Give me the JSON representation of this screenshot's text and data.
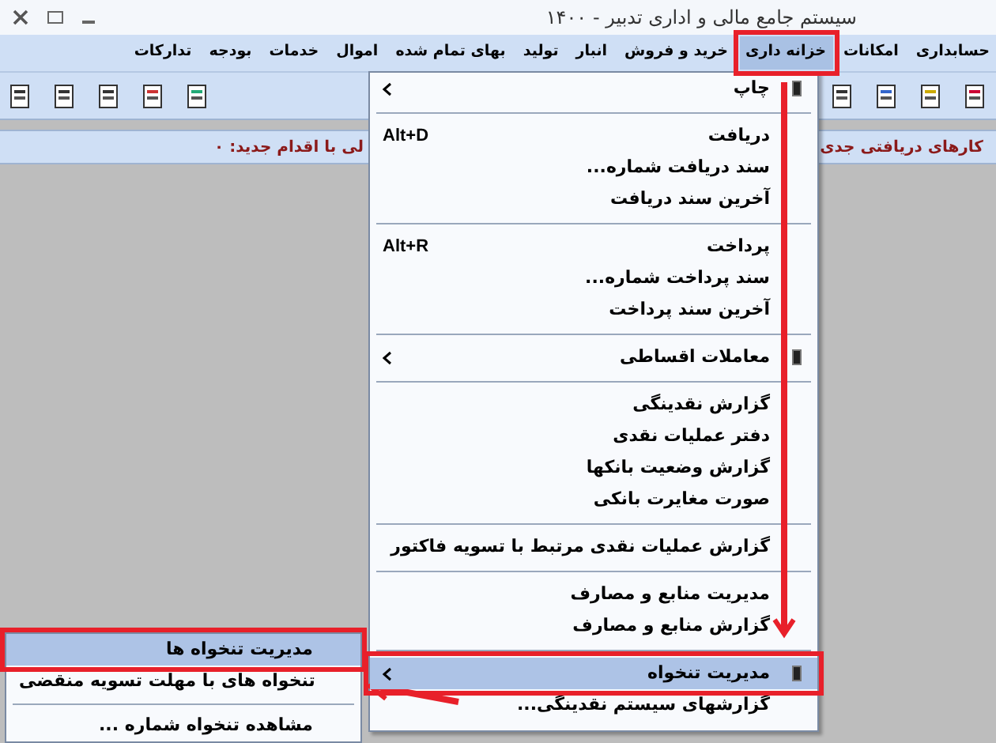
{
  "window": {
    "title": "سیستم جامع مالی و اداری تدبیر - ۱۴۰۰"
  },
  "menu_bar": [
    {
      "label": "حسابداری",
      "selected": false
    },
    {
      "label": "امکانات",
      "selected": false
    },
    {
      "label": "خزانه داری",
      "selected": true
    },
    {
      "label": "خرید و فروش",
      "selected": false
    },
    {
      "label": "انبار",
      "selected": false
    },
    {
      "label": "تولید",
      "selected": false
    },
    {
      "label": "بهای تمام شده",
      "selected": false
    },
    {
      "label": "اموال",
      "selected": false
    },
    {
      "label": "خدمات",
      "selected": false
    },
    {
      "label": "بودجه",
      "selected": false
    },
    {
      "label": "تدارکات",
      "selected": false
    }
  ],
  "info_bar": {
    "received_tasks": "کارهای دریافتی جدی",
    "new_actions": "لی با اقدام جدید: ۰"
  },
  "menu": [
    {
      "kind": "submenu",
      "label": "چاپ",
      "selected": false
    },
    {
      "kind": "separator"
    },
    {
      "kind": "item",
      "label": "دریافت",
      "shortcut": "Alt+D",
      "selected": false
    },
    {
      "kind": "item",
      "label": "سند دریافت شماره...",
      "selected": false
    },
    {
      "kind": "item",
      "label": "آخرین سند دریافت",
      "selected": false
    },
    {
      "kind": "separator"
    },
    {
      "kind": "item",
      "label": "پرداخت",
      "shortcut": "Alt+R",
      "selected": false
    },
    {
      "kind": "item",
      "label": "سند پرداخت شماره...",
      "selected": false
    },
    {
      "kind": "item",
      "label": "آخرین سند پرداخت",
      "selected": false
    },
    {
      "kind": "separator"
    },
    {
      "kind": "submenu",
      "label": "معاملات اقساطی",
      "selected": false
    },
    {
      "kind": "separator"
    },
    {
      "kind": "item",
      "label": "گزارش نقدینگی",
      "selected": false
    },
    {
      "kind": "item",
      "label": "دفتر عملیات نقدی",
      "selected": false
    },
    {
      "kind": "item",
      "label": "گزارش وضعیت بانکها",
      "selected": false
    },
    {
      "kind": "item",
      "label": "صورت مغایرت بانکی",
      "selected": false
    },
    {
      "kind": "separator"
    },
    {
      "kind": "item",
      "label": "گزارش عملیات نقدی مرتبط با تسویه فاکتور",
      "selected": false
    },
    {
      "kind": "separator"
    },
    {
      "kind": "item",
      "label": "مدیریت منابع و مصارف",
      "selected": false
    },
    {
      "kind": "item",
      "label": "گزارش منابع و مصارف",
      "selected": false
    },
    {
      "kind": "separator"
    },
    {
      "kind": "submenu",
      "label": "مدیریت تنخواه",
      "selected": true
    },
    {
      "kind": "item",
      "label": "گزارشهای سیستم نقدینگی...",
      "selected": false
    }
  ],
  "submenu": [
    {
      "kind": "item",
      "label": "مدیریت تنخواه ها",
      "selected": true
    },
    {
      "kind": "item",
      "label": "تنخواه های با مهلت تسویه منقضی",
      "selected": false
    },
    {
      "kind": "separator"
    },
    {
      "kind": "item",
      "label": "مشاهده تنخواه شماره ...",
      "selected": false
    }
  ]
}
